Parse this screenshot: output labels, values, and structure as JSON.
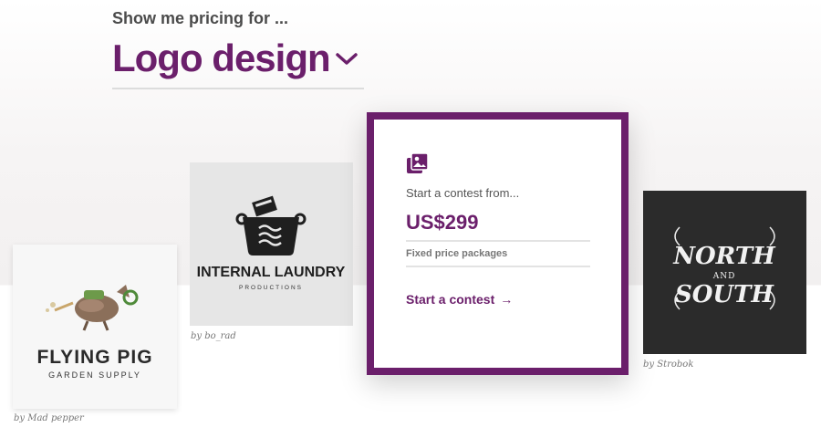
{
  "header": {
    "eyebrow": "Show me pricing for ...",
    "selected_category": "Logo design",
    "chevron_icon": "chevron-down-icon"
  },
  "colors": {
    "brand": "#6b1f6b",
    "text_gray": "#4b4b4b"
  },
  "cards": [
    {
      "id": "flying-pig",
      "logo_title": "FLYING PIG",
      "logo_subtitle": "GARDEN SUPPLY",
      "caption": "by Mad pepper"
    },
    {
      "id": "internal-laundry",
      "logo_title": "INTERNAL LAUNDRY",
      "logo_subtitle": "PRODUCTIONS",
      "caption": "by bo_rad"
    },
    {
      "id": "north-south",
      "logo_title": "NORTH",
      "logo_middle": "AND",
      "logo_subtitle": "SOUTH",
      "caption": "by Strobok"
    }
  ],
  "contest": {
    "icon": "photos-icon",
    "from_label": "Start a contest from...",
    "price": "US$299",
    "fixed_label": "Fixed price packages",
    "cta_label": "Start a contest",
    "cta_icon": "arrow-right-icon",
    "cta_arrow": "→"
  }
}
